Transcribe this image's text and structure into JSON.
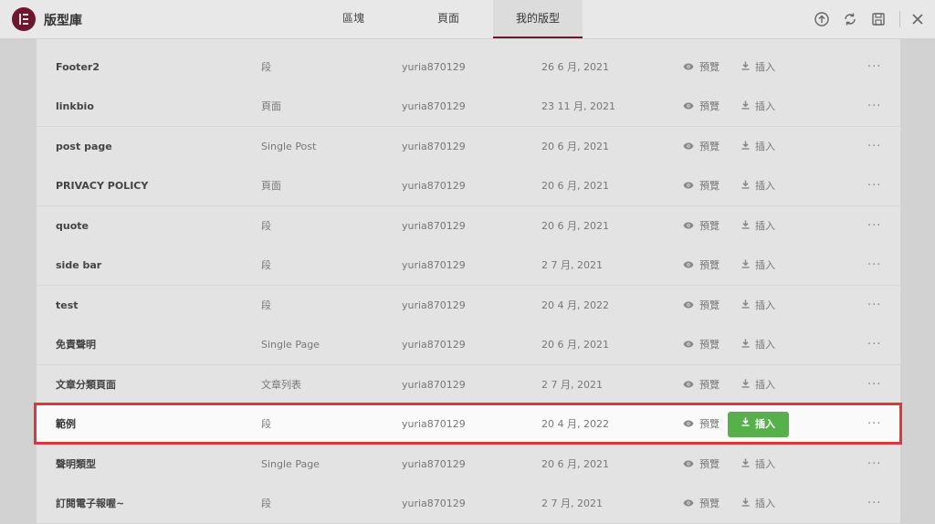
{
  "app": {
    "title": "版型庫"
  },
  "tabs": [
    {
      "label": "區塊"
    },
    {
      "label": "頁面"
    },
    {
      "label": "我的版型"
    }
  ],
  "actions": {
    "preview_label": "預覽",
    "insert_label": "插入",
    "more_label": "···"
  },
  "icons": [
    "logo-icon",
    "upload-icon",
    "sync-icon",
    "save-icon",
    "close-icon",
    "eye-icon",
    "download-icon"
  ],
  "colors": {
    "brand": "#6e1530",
    "insert_button": "#56b14a",
    "highlight_border": "#e0353c"
  },
  "templates": [
    {
      "name": "Footer2",
      "type": "段",
      "author": "yuria870129",
      "date": "26 6 月, 2021"
    },
    {
      "name": "linkbio",
      "type": "頁面",
      "author": "yuria870129",
      "date": "23 11 月, 2021"
    },
    {
      "name": "post page",
      "type": "Single Post",
      "author": "yuria870129",
      "date": "20 6 月, 2021"
    },
    {
      "name": "PRIVACY POLICY",
      "type": "頁面",
      "author": "yuria870129",
      "date": "20 6 月, 2021"
    },
    {
      "name": "quote",
      "type": "段",
      "author": "yuria870129",
      "date": "20 6 月, 2021"
    },
    {
      "name": "side bar",
      "type": "段",
      "author": "yuria870129",
      "date": "2 7 月, 2021"
    },
    {
      "name": "test",
      "type": "段",
      "author": "yuria870129",
      "date": "20 4 月, 2022"
    },
    {
      "name": "免責聲明",
      "type": "Single Page",
      "author": "yuria870129",
      "date": "20 6 月, 2021"
    },
    {
      "name": "文章分類頁面",
      "type": "文章列表",
      "author": "yuria870129",
      "date": "2 7 月, 2021"
    },
    {
      "name": "範例",
      "type": "段",
      "author": "yuria870129",
      "date": "20 4 月, 2022"
    },
    {
      "name": "聲明類型",
      "type": "Single Page",
      "author": "yuria870129",
      "date": "20 6 月, 2021"
    },
    {
      "name": "訂閱電子報喔~",
      "type": "段",
      "author": "yuria870129",
      "date": "2 7 月, 2021"
    }
  ]
}
